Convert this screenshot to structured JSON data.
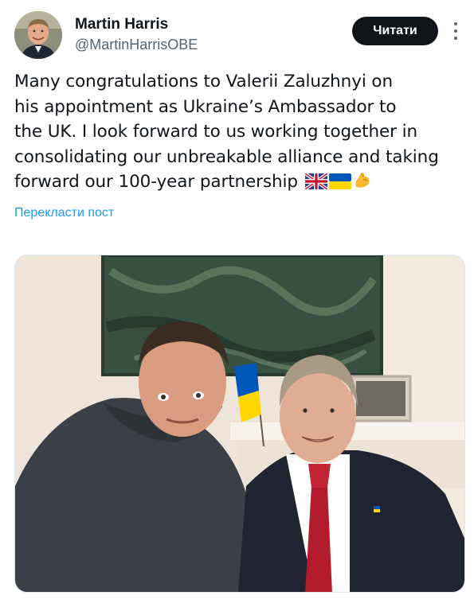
{
  "author": {
    "display_name": "Martin Harris",
    "handle": "@MartinHarrisOBE"
  },
  "follow_button_label": "Читати",
  "tweet": {
    "lines": [
      "Many congratulations to Valerii Zaluzhnyi on",
      "his appointment as Ukraine’s Ambassador to",
      "the UK. I look forward to us working together in",
      "consolidating our unbreakable alliance and taking",
      "forward our 100-year partnership"
    ],
    "emojis": [
      "uk-flag-icon",
      "ukraine-flag-icon",
      "flexed-biceps-icon"
    ]
  },
  "translate_label": "Перекласти пост",
  "colors": {
    "text": "#0f1419",
    "secondary": "#536471",
    "link": "#1d9bf0",
    "button_bg": "#0f1419"
  }
}
